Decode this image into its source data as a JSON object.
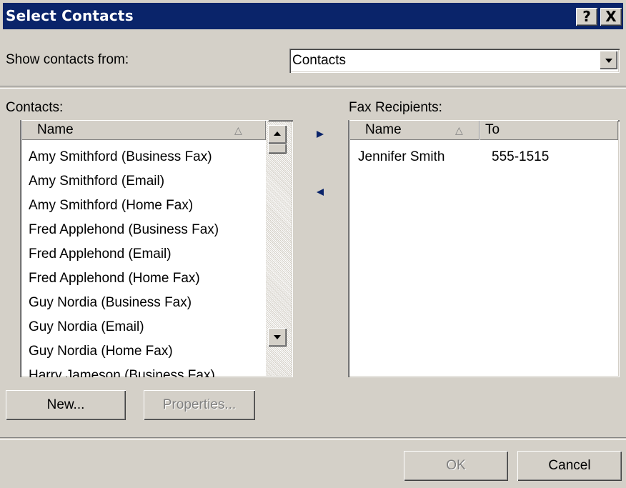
{
  "window": {
    "title": "Select Contacts",
    "help_label": "?",
    "close_label": "X"
  },
  "show_from": {
    "label": "Show contacts from:",
    "value": "Contacts"
  },
  "contacts": {
    "label": "Contacts:",
    "column_name": "Name",
    "sort_indicator": "△",
    "items": [
      "Amy Smithford (Business Fax)",
      "Amy Smithford (Email)",
      "Amy Smithford (Home Fax)",
      "Fred Applehond (Business Fax)",
      "Fred Applehond (Email)",
      "Fred Applehond (Home Fax)",
      "Guy Nordia (Business Fax)",
      "Guy Nordia (Email)",
      "Guy Nordia (Home Fax)",
      "Harry Jameson (Business Fax)"
    ]
  },
  "recipients": {
    "label": "Fax Recipients:",
    "col_name": "Name",
    "col_to": "To",
    "sort_indicator": "△",
    "rows": [
      {
        "name": "Jennifer Smith",
        "to": "555-1515"
      }
    ]
  },
  "buttons": {
    "new": "New...",
    "properties": "Properties...",
    "ok": "OK",
    "cancel": "Cancel"
  },
  "colors": {
    "titlebar": "#0a246a",
    "dialog": "#d4d0c8",
    "mover_arrow": "#0a246a"
  }
}
